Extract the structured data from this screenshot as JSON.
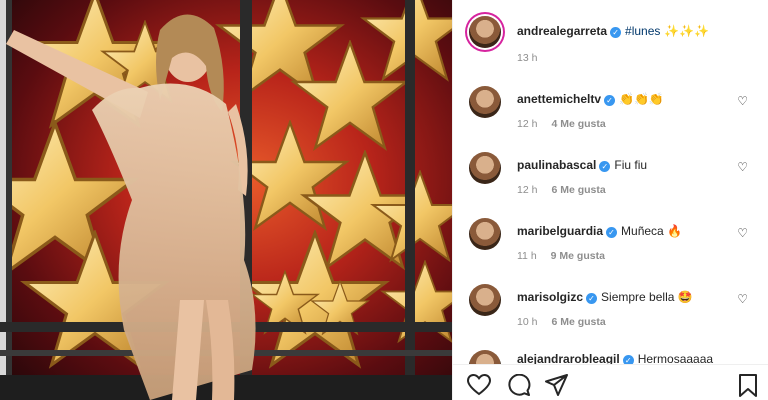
{
  "post": {
    "author": "andrealegarreta",
    "caption_hashtag": "#lunes",
    "caption_emojis": "✨✨✨",
    "time": "13 h"
  },
  "comments": [
    {
      "user": "anettemicheltv",
      "text": "👏👏👏",
      "time": "12 h",
      "likes": "4 Me gusta"
    },
    {
      "user": "paulinabascal",
      "text": "Fiu fiu",
      "time": "12 h",
      "likes": "6 Me gusta"
    },
    {
      "user": "maribelguardia",
      "text": "Muñeca 🔥",
      "time": "11 h",
      "likes": "9 Me gusta"
    },
    {
      "user": "marisolgizc",
      "text": "Siempre bella 🤩",
      "time": "10 h",
      "likes": "6 Me gusta"
    },
    {
      "user": "alejandrarobleagil",
      "text": "Hermosaaaaa"
    }
  ],
  "icons": {
    "like": "heart-icon",
    "comment": "comment-icon",
    "share": "share-icon",
    "save": "bookmark-icon"
  },
  "colors": {
    "verified": "#3897f0",
    "hashtag": "#00376b",
    "meta": "#8e8e8e"
  }
}
